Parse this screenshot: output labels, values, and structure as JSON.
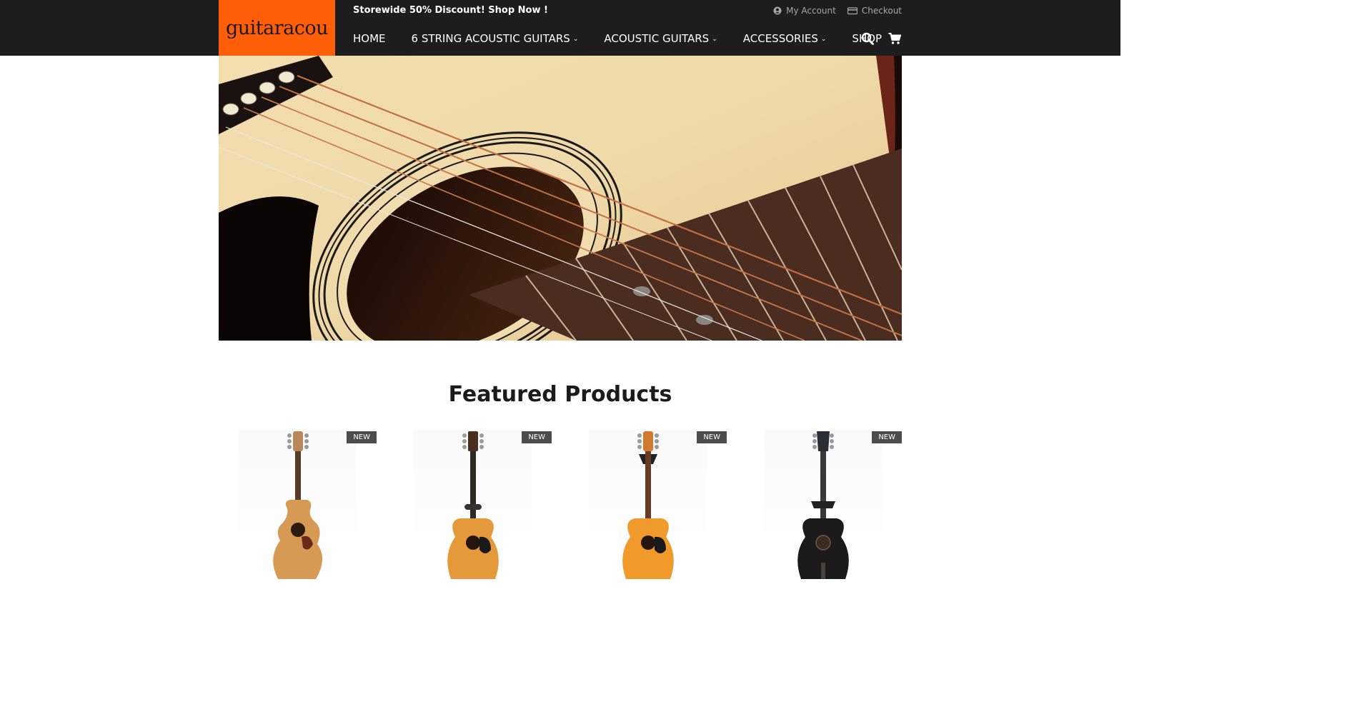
{
  "header": {
    "logo_text": "guitaracou",
    "promo": "Storewide 50% Discount! Shop Now !",
    "account_label": "My Account",
    "checkout_label": "Checkout",
    "nav": [
      {
        "label": "HOME",
        "has_dropdown": false
      },
      {
        "label": "6 STRING ACOUSTIC GUITARS",
        "has_dropdown": true
      },
      {
        "label": "ACOUSTIC GUITARS",
        "has_dropdown": true
      },
      {
        "label": "ACCESSORIES",
        "has_dropdown": true
      },
      {
        "label": "SHOP",
        "has_dropdown": false
      }
    ],
    "icons": {
      "search": "search-icon",
      "cart": "cart-icon",
      "account": "user-icon",
      "checkout": "card-icon"
    }
  },
  "featured": {
    "title": "Featured Products",
    "products": [
      {
        "badge": "NEW",
        "guitar_color": "natural-cutaway"
      },
      {
        "badge": "NEW",
        "guitar_color": "natural"
      },
      {
        "badge": "NEW",
        "guitar_color": "orange"
      },
      {
        "badge": "NEW",
        "guitar_color": "black"
      }
    ]
  },
  "colors": {
    "header_bg": "#1d1d1d",
    "logo_bg": "#ff5e08",
    "badge_bg": "#4c4c4c"
  }
}
